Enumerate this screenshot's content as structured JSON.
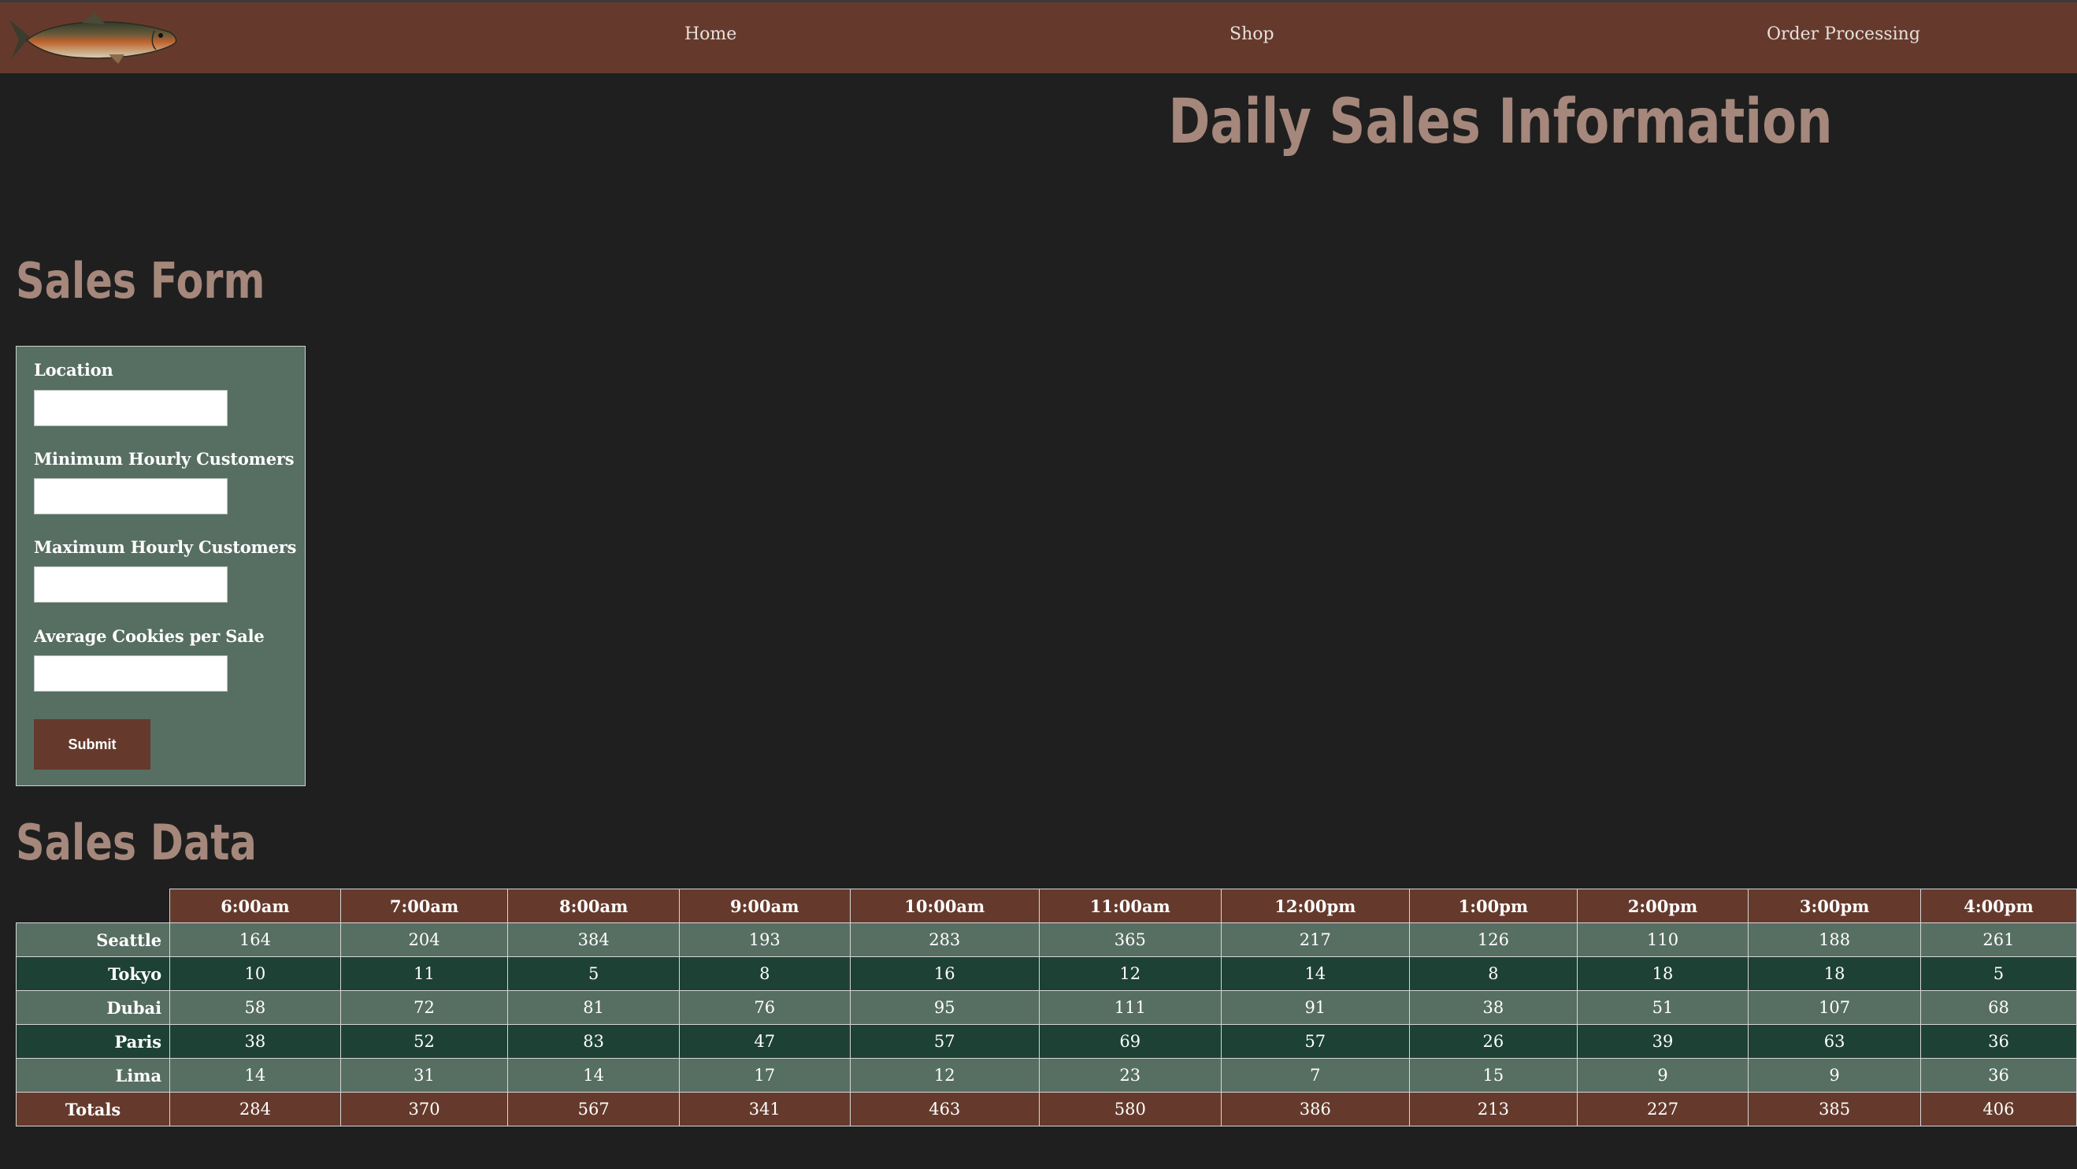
{
  "nav": {
    "logo_icon": "salmon-fish-logo-icon",
    "links": [
      "Home",
      "Shop",
      "Order Processing"
    ]
  },
  "page_title": "Daily Sales Information",
  "sales_form": {
    "title": "Sales Form",
    "fields": [
      {
        "label": "Location",
        "value": ""
      },
      {
        "label": "Minimum Hourly Customers",
        "value": ""
      },
      {
        "label": "Maximum Hourly Customers",
        "value": ""
      },
      {
        "label": "Average Cookies per Sale",
        "value": ""
      }
    ],
    "submit_label": "Submit"
  },
  "sales_data": {
    "title": "Sales Data",
    "hours": [
      "6:00am",
      "7:00am",
      "8:00am",
      "9:00am",
      "10:00am",
      "11:00am",
      "12:00pm",
      "1:00pm",
      "2:00pm",
      "3:00pm",
      "4:00pm"
    ],
    "rows": [
      {
        "name": "Seattle",
        "values": [
          "164",
          "204",
          "384",
          "193",
          "283",
          "365",
          "217",
          "126",
          "110",
          "188",
          "261"
        ]
      },
      {
        "name": "Tokyo",
        "values": [
          "10",
          "11",
          "5",
          "8",
          "16",
          "12",
          "14",
          "8",
          "18",
          "18",
          "5"
        ]
      },
      {
        "name": "Dubai",
        "values": [
          "58",
          "72",
          "81",
          "76",
          "95",
          "111",
          "91",
          "38",
          "51",
          "107",
          "68"
        ]
      },
      {
        "name": "Paris",
        "values": [
          "38",
          "52",
          "83",
          "47",
          "57",
          "69",
          "57",
          "26",
          "39",
          "63",
          "36"
        ]
      },
      {
        "name": "Lima",
        "values": [
          "14",
          "31",
          "14",
          "17",
          "12",
          "23",
          "7",
          "15",
          "9",
          "9",
          "36"
        ]
      }
    ],
    "totals": {
      "name": "Totals",
      "values": [
        "284",
        "370",
        "567",
        "341",
        "463",
        "580",
        "386",
        "213",
        "227",
        "385",
        "406"
      ]
    }
  },
  "colors": {
    "page_background": "#1f1f1f",
    "nav_brown": "#653a2c",
    "heading_tan": "#a5877b",
    "form_green": "#576e63",
    "row_light_green": "#576e63",
    "row_dark_green": "#1d4134"
  }
}
